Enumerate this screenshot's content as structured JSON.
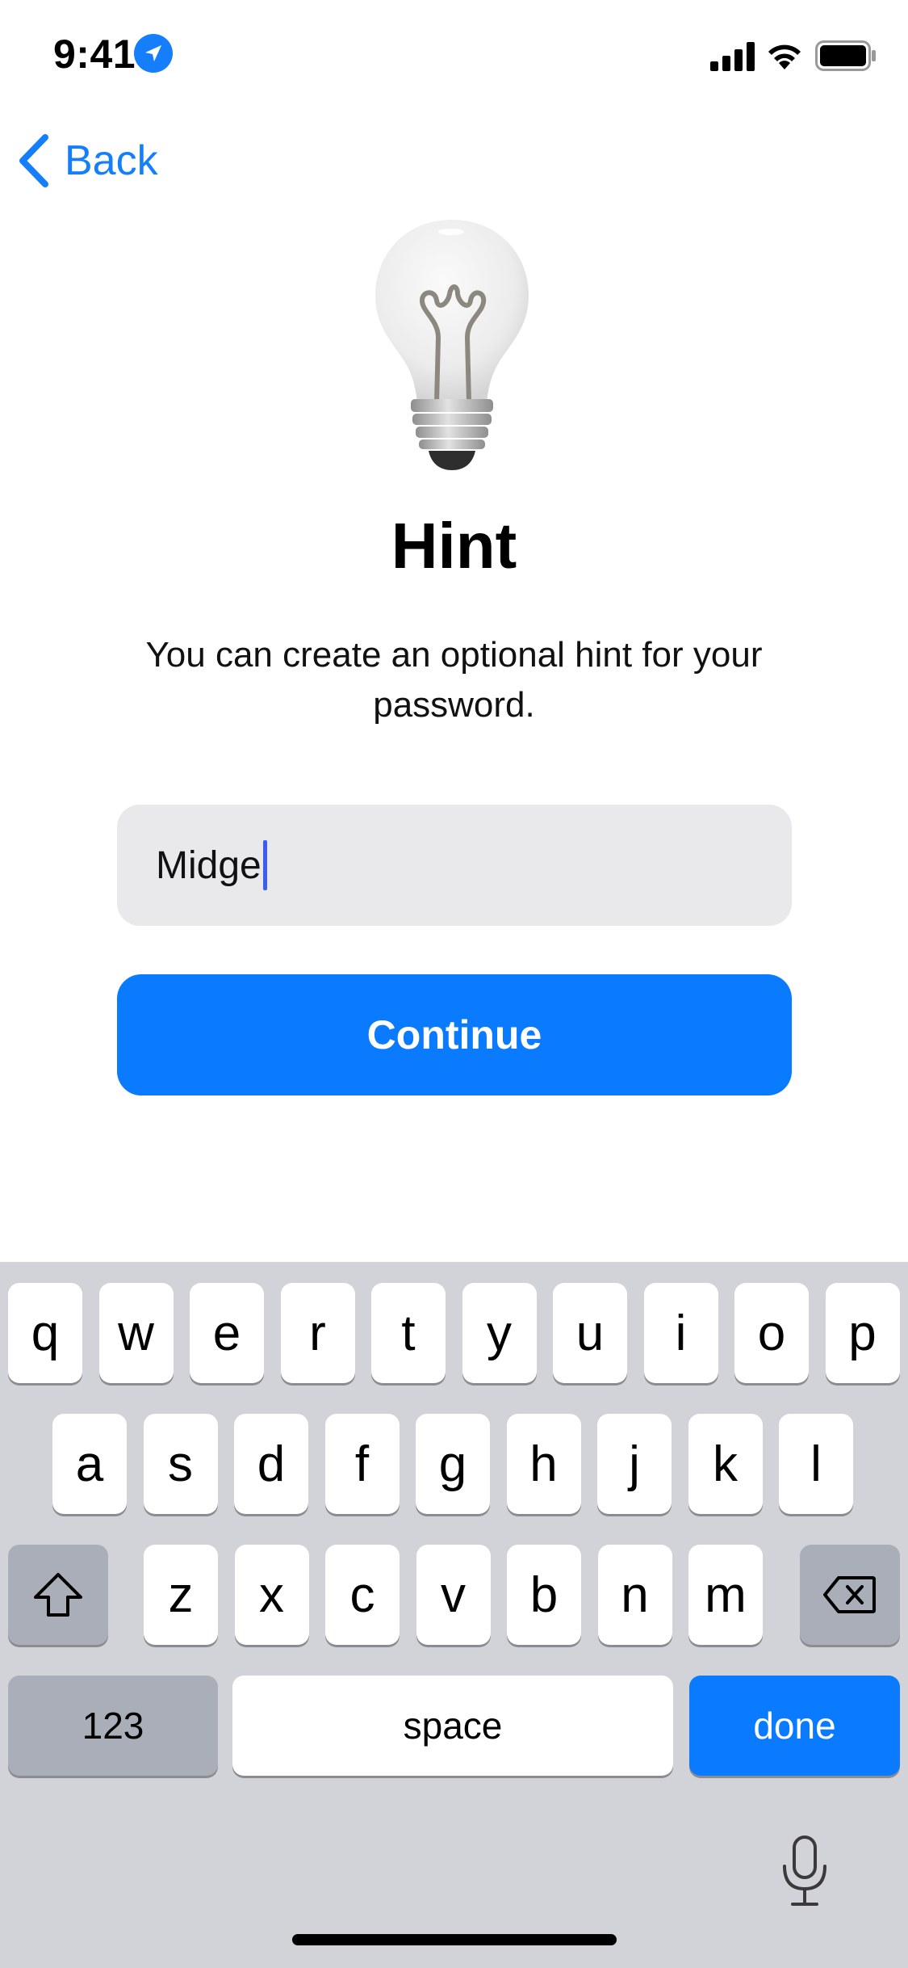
{
  "status_bar": {
    "time": "9:41"
  },
  "nav": {
    "back_label": "Back"
  },
  "content": {
    "title": "Hint",
    "subtitle": "You can create an optional hint for your password.",
    "hint_value": "Midge",
    "continue_label": "Continue"
  },
  "keyboard": {
    "row1": [
      "q",
      "w",
      "e",
      "r",
      "t",
      "y",
      "u",
      "i",
      "o",
      "p"
    ],
    "row2": [
      "a",
      "s",
      "d",
      "f",
      "g",
      "h",
      "j",
      "k",
      "l"
    ],
    "row3": [
      "z",
      "x",
      "c",
      "v",
      "b",
      "n",
      "m"
    ],
    "numbers_label": "123",
    "space_label": "space",
    "done_label": "done"
  },
  "colors": {
    "accent": "#0A7AFF",
    "field_bg": "#E9E9EB",
    "keyboard_bg": "#D1D3D9"
  },
  "icons": [
    "location-icon",
    "signal-icon",
    "wifi-icon",
    "battery-icon",
    "back-chevron-icon",
    "lightbulb-icon",
    "shift-icon",
    "delete-icon",
    "microphone-icon"
  ]
}
